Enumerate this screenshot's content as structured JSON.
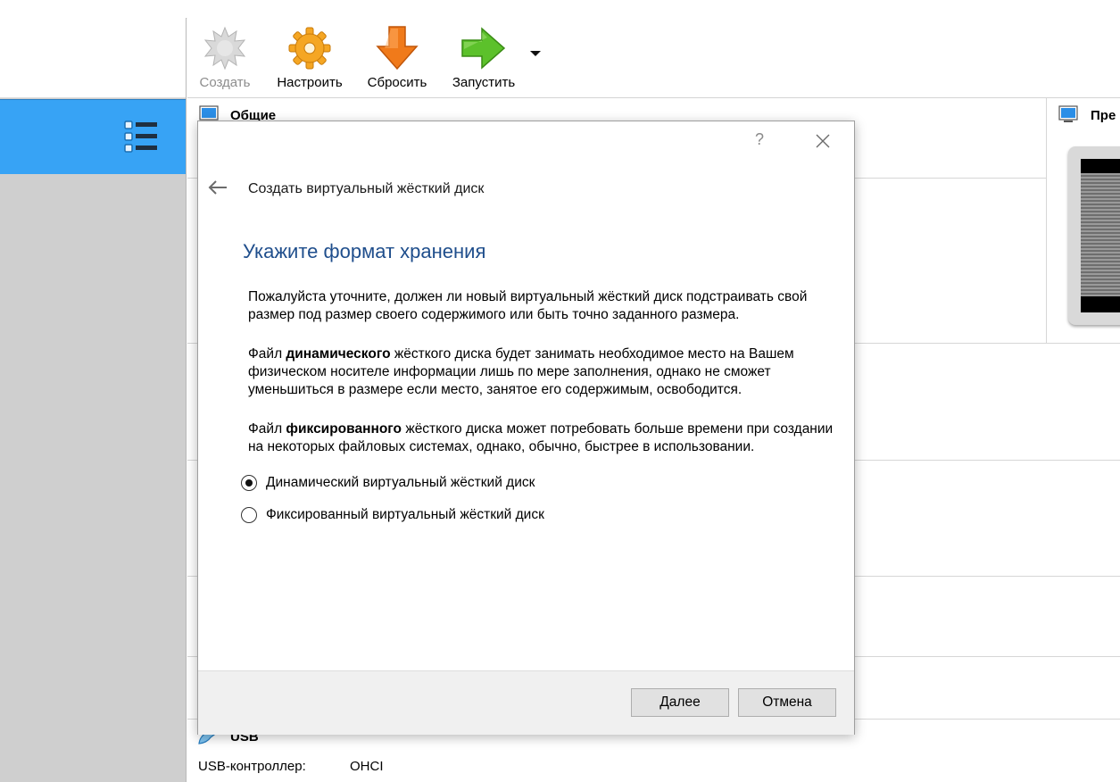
{
  "toolbar": {
    "create_label": "Создать",
    "configure_label": "Настроить",
    "reset_label": "Сбросить",
    "start_label": "Запустить"
  },
  "details": {
    "general_heading": "Общие",
    "preview_heading": "Пре",
    "usb_heading": "USB",
    "usb_controller_label": "USB-контроллер:",
    "usb_controller_value": "OHCI"
  },
  "dialog": {
    "help_glyph": "?",
    "title": "Создать виртуальный жёсткий диск",
    "heading": "Укажите формат хранения",
    "para1": "Пожалуйста уточните, должен ли новый виртуальный жёсткий диск подстраивать свой размер под размер своего содержимого или быть точно заданного размера.",
    "para2_prefix": "Файл ",
    "para2_bold": "динамического",
    "para2_suffix": " жёсткого диска будет занимать необходимое место на Вашем физическом носителе информации лишь по мере заполнения, однако не сможет уменьшиться в размере если место, занятое его содержимым, освободится.",
    "para3_prefix": "Файл ",
    "para3_bold": "фиксированного",
    "para3_suffix": " жёсткого диска может потребовать больше времени при создании на некоторых файловых системах, однако, обычно, быстрее в использовании.",
    "options": [
      {
        "label": "Динамический виртуальный жёсткий диск",
        "selected": true
      },
      {
        "label": "Фиксированный виртуальный жёсткий диск",
        "selected": false
      }
    ],
    "next_label": "Далее",
    "cancel_label": "Отмена"
  },
  "colors": {
    "selected_item": "#37a3f5",
    "heading": "#1f4e8c",
    "gear": "#f5a623",
    "reset_arrow": "#f07a1a",
    "start_arrow": "#5cc12b"
  },
  "icons": {
    "tools": "list-icon",
    "create": "starburst-icon",
    "configure": "gear-icon",
    "reset": "down-arrow-icon",
    "start": "right-arrow-icon"
  }
}
